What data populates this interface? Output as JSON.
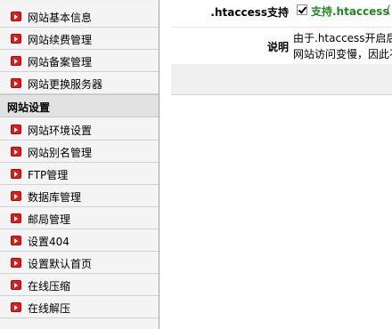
{
  "sidebar": {
    "items_top": [
      {
        "label": "网站基本信息"
      },
      {
        "label": "网站续费管理"
      },
      {
        "label": "网站备案管理"
      },
      {
        "label": "网站更换服务器"
      }
    ],
    "section": {
      "label": "网站设置"
    },
    "items_bottom": [
      {
        "label": "网站环境设置"
      },
      {
        "label": "网站别名管理"
      },
      {
        "label": "FTP管理"
      },
      {
        "label": "数据库管理"
      },
      {
        "label": "邮局管理"
      },
      {
        "label": "设置404"
      },
      {
        "label": "设置默认首页"
      },
      {
        "label": "在线压缩"
      },
      {
        "label": "在线解压"
      }
    ]
  },
  "main": {
    "htaccess": {
      "label": ".htaccess支持",
      "checked": true,
      "value": "支持.htaccess",
      "trail": "("
    },
    "description": {
      "label": "说明",
      "line1": "由于.htaccess开启后",
      "line2": "网站访问变慢，因此不"
    }
  },
  "colors": {
    "bullet_red": "#e01b1b",
    "support_green": "#1b8a1b",
    "sidebar_bg": "#f3f3f3",
    "section_bg": "#e2e2e2"
  }
}
